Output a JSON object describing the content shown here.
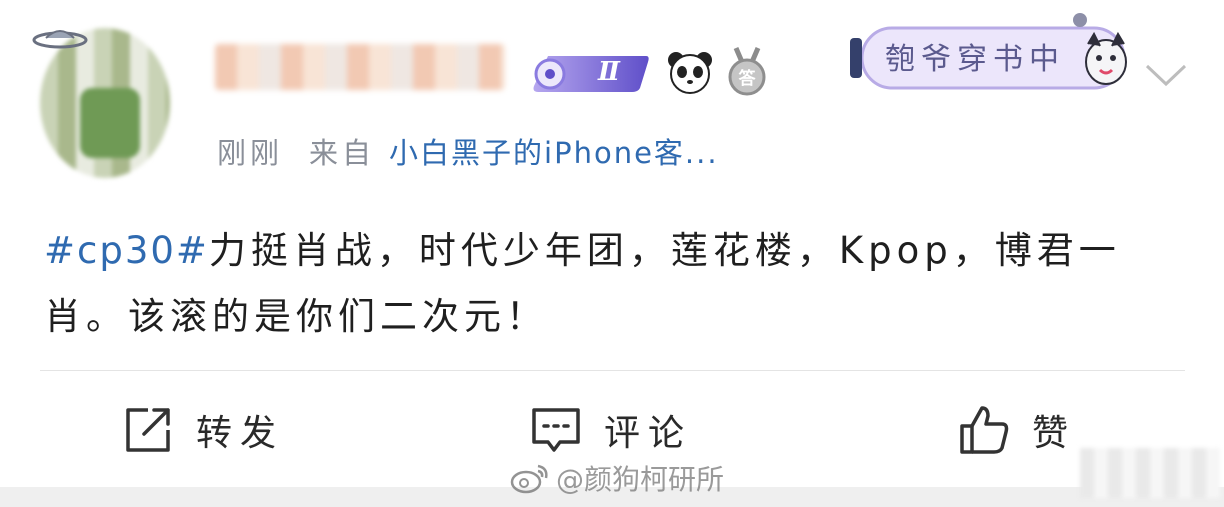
{
  "user": {
    "level_badge": "Ⅱ",
    "status_text": "匏爷穿书中"
  },
  "meta": {
    "time": "刚刚",
    "from_label": "来自",
    "source": "小白黑子的iPhone客..."
  },
  "post": {
    "hashtag": "#cp30#",
    "body": "力挺肖战，时代少年团，莲花楼，Kpop，博君一肖。该滚的是你们二次元！"
  },
  "actions": {
    "forward_label": "转发",
    "comment_label": "评论",
    "like_label": "赞"
  },
  "watermark": {
    "text": "@颜狗柯研所"
  },
  "colors": {
    "link": "#2f6ab0",
    "meta": "#8a8f99",
    "status": "#5b5a8e"
  }
}
